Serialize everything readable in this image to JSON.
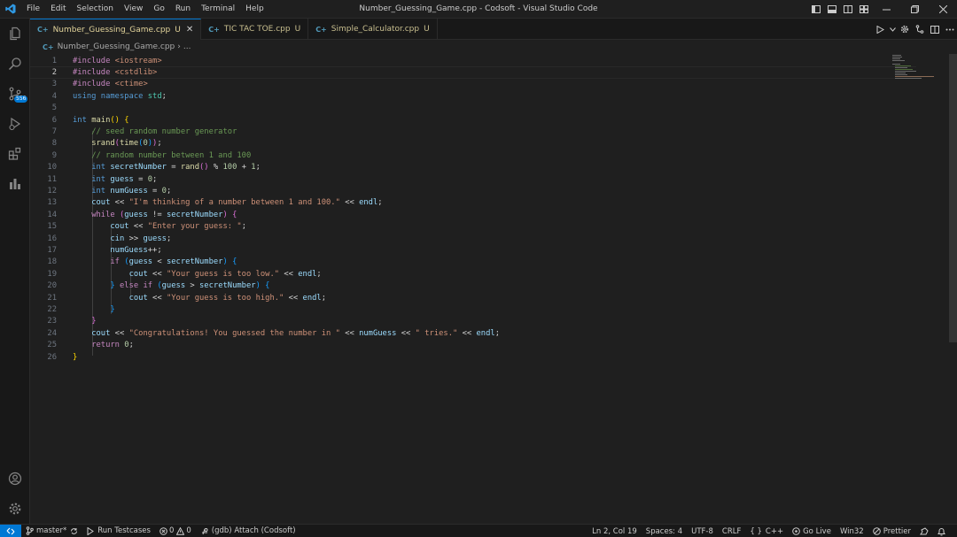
{
  "window": {
    "title": "Number_Guessing_Game.cpp - Codsoft - Visual Studio Code"
  },
  "menu": [
    "File",
    "Edit",
    "Selection",
    "View",
    "Go",
    "Run",
    "Terminal",
    "Help"
  ],
  "activity": {
    "source_control_badge": "556"
  },
  "tabs": [
    {
      "label": "Number_Guessing_Game.cpp",
      "status": "U",
      "active": true
    },
    {
      "label": "TIC TAC TOE.cpp",
      "status": "U",
      "active": false
    },
    {
      "label": "Simple_Calculator.cpp",
      "status": "U",
      "active": false
    }
  ],
  "breadcrumb": {
    "file": "Number_Guessing_Game.cpp",
    "ellipsis": "..."
  },
  "editor": {
    "current_line": 2,
    "line_numbers": [
      "1",
      "2",
      "3",
      "4",
      "5",
      "6",
      "7",
      "8",
      "9",
      "10",
      "11",
      "12",
      "13",
      "14",
      "15",
      "16",
      "17",
      "18",
      "19",
      "20",
      "21",
      "22",
      "23",
      "24",
      "25",
      "26"
    ]
  },
  "statusbar": {
    "branch": "master*",
    "run_testcases": "Run Testcases",
    "errors": "0",
    "warnings": "0",
    "debug": "(gdb) Attach (Codsoft)",
    "cursor": "Ln 2, Col 19",
    "spaces": "Spaces: 4",
    "encoding": "UTF-8",
    "eol": "CRLF",
    "language_braces": "{ }",
    "language": "C++",
    "go_live": "Go Live",
    "platform": "Win32",
    "prettier": "Prettier"
  },
  "colors": {
    "accent": "#0078d4",
    "background": "#1f1f1f",
    "modified_tab": "#e3d49b"
  }
}
